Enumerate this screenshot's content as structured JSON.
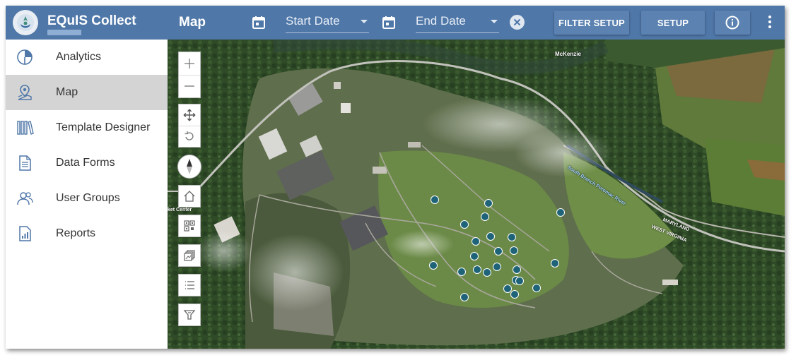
{
  "app": {
    "title": "EQuIS Collect",
    "page_title": "Map"
  },
  "filters": {
    "start_date_placeholder": "Start Date",
    "end_date_placeholder": "End Date"
  },
  "toolbar": {
    "filter_setup_label": "FILTER SETUP",
    "setup_label": "SETUP"
  },
  "sidebar": {
    "items": [
      {
        "label": "Analytics",
        "icon": "pie-chart-icon"
      },
      {
        "label": "Map",
        "icon": "map-pin-icon",
        "active": true
      },
      {
        "label": "Template Designer",
        "icon": "books-icon"
      },
      {
        "label": "Data Forms",
        "icon": "document-icon"
      },
      {
        "label": "User Groups",
        "icon": "users-icon"
      },
      {
        "label": "Reports",
        "icon": "report-icon"
      }
    ]
  },
  "map": {
    "labels": {
      "mckenzie": "McKenzie",
      "river": "South Branch Potomac River",
      "state_line_1": "MARYLAND",
      "state_line_2": "WEST VIRGINIA",
      "site_center": "ket Center"
    },
    "controls": [
      "zoom-in",
      "zoom-out",
      "pan",
      "rotate",
      "compass",
      "home",
      "extent",
      "layers",
      "legend",
      "filter"
    ],
    "colors": {
      "marker": "#1e6378",
      "header": "#4f77a8"
    }
  }
}
